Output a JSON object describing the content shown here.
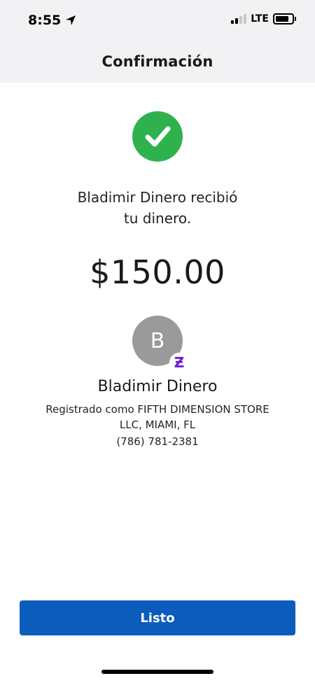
{
  "status_bar": {
    "time": "8:55",
    "location_icon": "location-arrow-icon",
    "network": "LTE",
    "signal_icon": "cellular-signal-icon",
    "battery_icon": "battery-icon"
  },
  "nav": {
    "title": "Confirmación"
  },
  "confirmation": {
    "check_icon": "checkmark-circle-icon",
    "check_color": "#2fb24e",
    "message_line1": "Bladimir Dinero recibió",
    "message_line2": "tu dinero.",
    "amount": "$150.00"
  },
  "recipient": {
    "avatar_initial": "B",
    "badge_icon": "zelle-logo-icon",
    "badge_symbol": "Ƶ",
    "badge_color": "#6d1ed4",
    "name": "Bladimir Dinero",
    "registered_line1": "Registrado como FIFTH DIMENSION STORE",
    "registered_line2": "LLC, MIAMI, FL",
    "phone": "(786) 781-2381"
  },
  "actions": {
    "done_label": "Listo",
    "done_color": "#0b5cbd"
  }
}
